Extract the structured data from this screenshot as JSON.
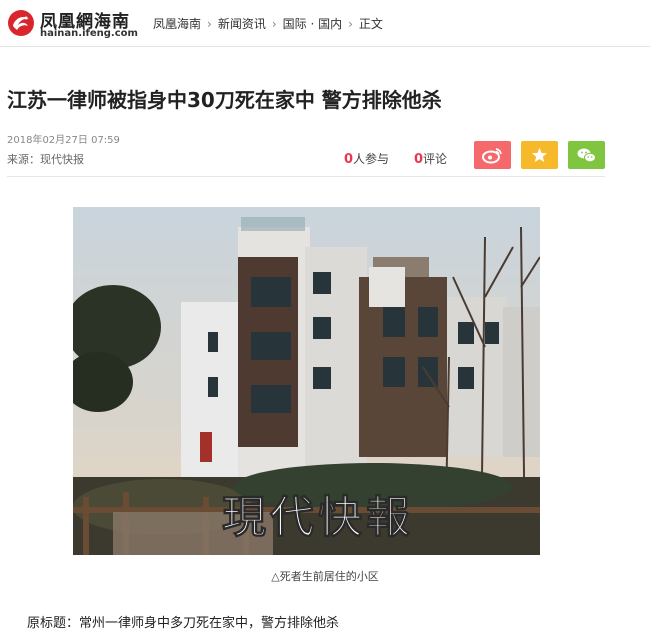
{
  "header": {
    "logo_cn": "凤凰網海南",
    "logo_en": "hainan.ifeng.com",
    "breadcrumb": [
      "凤凰海南",
      "新闻资讯",
      "国际 · 国内",
      "正文"
    ],
    "separator": "›"
  },
  "article": {
    "title": "江苏一律师被指身中30刀死在家中 警方排除他杀",
    "date": "2018年02月27日 07:59",
    "source": "来源：现代快报",
    "participants_count": "0",
    "participants_label": "人参与",
    "comments_count": "0",
    "comments_label": "评论",
    "image_watermark": "現代快報",
    "image_caption": "△死者生前居住的小区",
    "paragraph": "原标题：常州一律师身中多刀死在家中，警方排除他杀"
  },
  "share": {
    "weibo_color": "#f5696c",
    "favorite_color": "#f6b92c",
    "wechat_color": "#7fc53f",
    "icons": [
      "weibo-icon",
      "star-icon",
      "wechat-icon"
    ]
  },
  "colors": {
    "accent_red": "#e8384f",
    "logo_red": "#d9262c"
  }
}
